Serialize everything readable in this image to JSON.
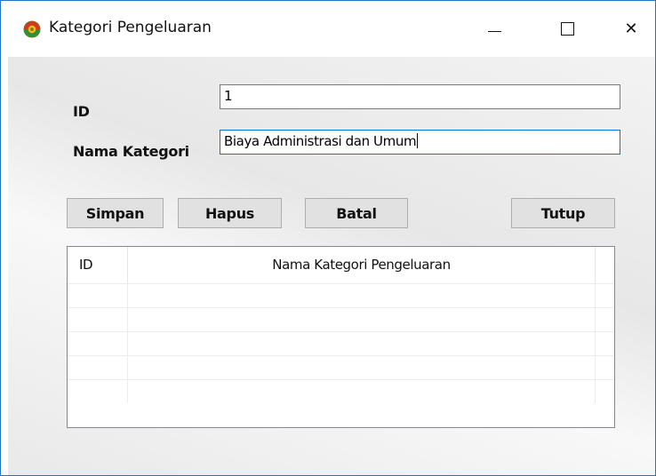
{
  "window": {
    "title": "Kategori Pengeluaran",
    "controls": {
      "minimize_icon": "minimize-icon",
      "maximize_icon": "maximize-icon",
      "close_icon": "close-icon",
      "close_glyph": "✕"
    }
  },
  "form": {
    "id_label": "ID",
    "id_value": "1",
    "nama_label": "Nama Kategori",
    "nama_value": "Biaya Administrasi dan Umum"
  },
  "buttons": {
    "simpan": "Simpan",
    "hapus": "Hapus",
    "batal": "Batal",
    "tutup": "Tutup"
  },
  "grid": {
    "columns": [
      "ID",
      "Nama Kategori Pengeluaran"
    ],
    "rows": [
      [
        "",
        ""
      ],
      [
        "",
        ""
      ],
      [
        "",
        ""
      ],
      [
        "",
        ""
      ],
      [
        "",
        ""
      ]
    ]
  },
  "colors": {
    "window_border": "#1f74c8",
    "focus_border": "#0078d7",
    "button_face": "#e1e1e1"
  }
}
